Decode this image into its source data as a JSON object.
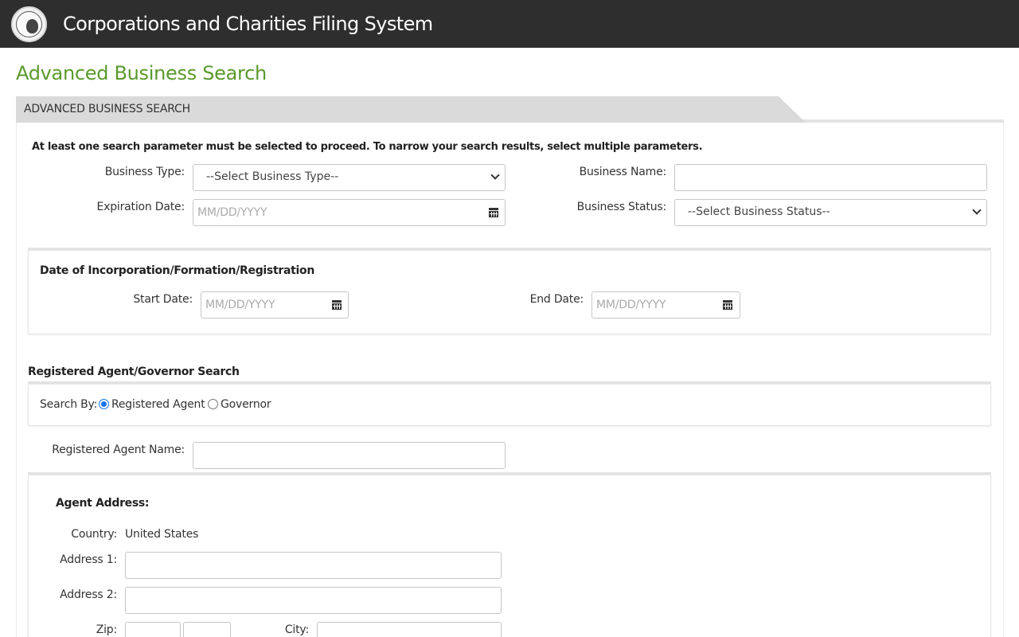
{
  "app": {
    "title": "Corporations and Charities Filing System"
  },
  "page": {
    "title": "Advanced Business Search"
  },
  "panel": {
    "heading": "ADVANCED BUSINESS SEARCH"
  },
  "note": "At least one search parameter must be selected to proceed. To narrow your search results, select multiple parameters.",
  "fields": {
    "business_type": {
      "label": "Business Type:",
      "value": "--Select Business Type--"
    },
    "business_name": {
      "label": "Business Name:",
      "value": ""
    },
    "expiration_date": {
      "label": "Expiration Date:",
      "placeholder": "MM/DD/YYYY"
    },
    "business_status": {
      "label": "Business Status:",
      "value": "--Select Business Status--"
    }
  },
  "incorporation": {
    "heading": "Date of Incorporation/Formation/Registration",
    "start_label": "Start Date:",
    "start_placeholder": "MM/DD/YYYY",
    "end_label": "End Date:",
    "end_placeholder": "MM/DD/YYYY"
  },
  "agent_search": {
    "heading": "Registered Agent/Governor Search",
    "search_by_label": "Search By:",
    "options": [
      {
        "label": "Registered Agent",
        "selected": true
      },
      {
        "label": "Governor",
        "selected": false
      }
    ],
    "name_label": "Registered Agent Name:"
  },
  "agent_address": {
    "heading": "Agent Address:",
    "country_label": "Country:",
    "country_value": "United States",
    "address1_label": "Address 1:",
    "address2_label": "Address 2:",
    "zip_label": "Zip:",
    "city_label": "City:"
  },
  "colors": {
    "header_bg": "#2e2e2e",
    "title_green": "#5a9a2c",
    "radio_blue": "#1a73e8"
  },
  "icons": [
    "state-seal-logo",
    "calendar-icon",
    "chevron-down-icon"
  ]
}
